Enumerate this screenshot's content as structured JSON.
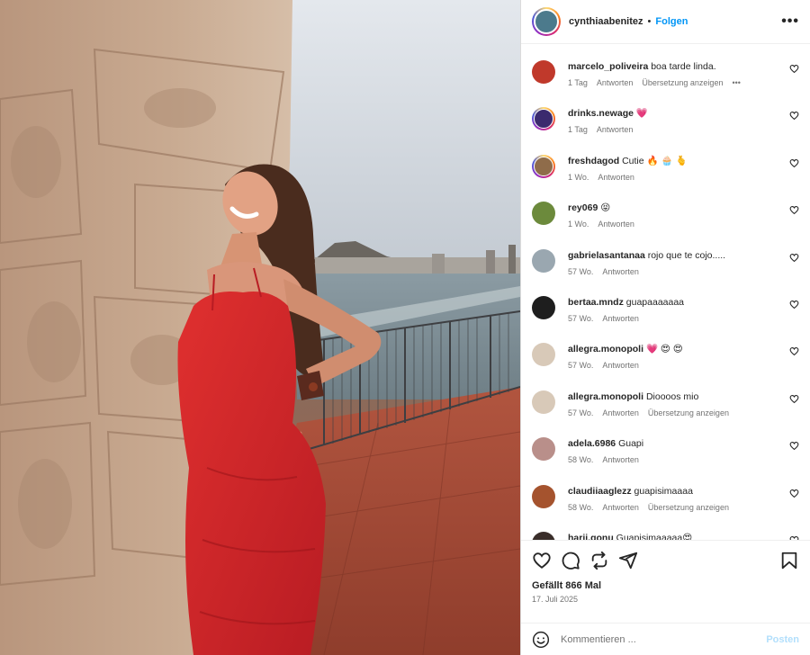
{
  "post": {
    "author": "cynthiaabenitez",
    "separator": "•",
    "follow_label": "Folgen",
    "more_icon": "more-horizontal-icon"
  },
  "comments": [
    {
      "user": "marcelo_poliveira",
      "text": "boa tarde linda.",
      "time": "1 Tag",
      "reply": "Antworten",
      "translate": "Übersetzung anzeigen",
      "more": "•••",
      "avatar_color": "#c0392b",
      "ring": false
    },
    {
      "user": "drinks.newage",
      "text": "💗",
      "time": "1 Tag",
      "reply": "Antworten",
      "translate": "",
      "more": "",
      "avatar_color": "#3b2a6e",
      "ring": true
    },
    {
      "user": "freshdagod",
      "text": "Cutie 🔥 🧁 🫰",
      "time": "1 Wo.",
      "reply": "Antworten",
      "translate": "",
      "more": "",
      "avatar_color": "#8f6c4a",
      "ring": true
    },
    {
      "user": "rey069",
      "text": "😝",
      "time": "1 Wo.",
      "reply": "Antworten",
      "translate": "",
      "more": "",
      "avatar_color": "#6c8a3c",
      "ring": false
    },
    {
      "user": "gabrielasantanaa",
      "text": "rojo que te cojo.....",
      "time": "57 Wo.",
      "reply": "Antworten",
      "translate": "",
      "more": "",
      "avatar_color": "#9aa7b0",
      "ring": false
    },
    {
      "user": "bertaa.mndz",
      "text": "guapaaaaaaa",
      "time": "57 Wo.",
      "reply": "Antworten",
      "translate": "",
      "more": "",
      "avatar_color": "#1e1e1e",
      "ring": false
    },
    {
      "user": "allegra.monopoli",
      "text": "💗 😍 😍",
      "time": "57 Wo.",
      "reply": "Antworten",
      "translate": "",
      "more": "",
      "avatar_color": "#d8c9b8",
      "ring": false
    },
    {
      "user": "allegra.monopoli",
      "text": "Dioooos mio",
      "time": "57 Wo.",
      "reply": "Antworten",
      "translate": "Übersetzung anzeigen",
      "more": "",
      "avatar_color": "#d8c9b8",
      "ring": false
    },
    {
      "user": "adela.6986",
      "text": "Guapi",
      "time": "58 Wo.",
      "reply": "Antworten",
      "translate": "",
      "more": "",
      "avatar_color": "#b98f8a",
      "ring": false
    },
    {
      "user": "claudiiaaglezz",
      "text": "guapisimaaaa",
      "time": "58 Wo.",
      "reply": "Antworten",
      "translate": "Übersetzung anzeigen",
      "more": "",
      "avatar_color": "#a5532e",
      "ring": false
    },
    {
      "user": "harii.gonu",
      "text": "Guapisimaaaaa😍",
      "time": "",
      "reply": "",
      "translate": "",
      "more": "",
      "avatar_color": "#3a2e2a",
      "ring": false
    }
  ],
  "actions": {
    "like_icon": "heart-icon",
    "comment_icon": "comment-icon",
    "repost_icon": "repost-icon",
    "share_icon": "share-icon",
    "save_icon": "bookmark-icon",
    "likes_text": "Gefällt 866 Mal",
    "date_text": "17. Juli 2025"
  },
  "composer": {
    "placeholder": "Kommentieren ...",
    "post_label": "Posten",
    "emoji_icon": "emoji-icon"
  },
  "colors": {
    "accent": "#0095f6",
    "post_disabled": "#b2dffc",
    "dress": "#d8262b"
  }
}
